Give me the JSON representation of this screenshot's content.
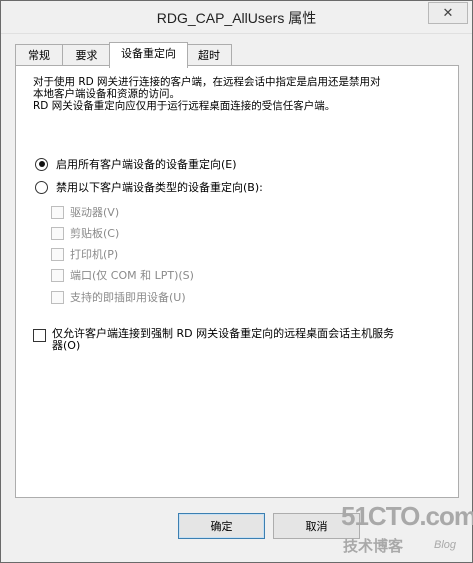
{
  "window": {
    "title": "RDG_CAP_AllUsers 属性",
    "close_glyph": "✕"
  },
  "tabs": [
    {
      "label": "常规"
    },
    {
      "label": "要求"
    },
    {
      "label": "设备重定向"
    },
    {
      "label": "超时"
    }
  ],
  "active_tab": "设备重定向",
  "description": {
    "line1": "对于使用 RD 网关进行连接的客户端，在远程会话中指定是启用还是禁用对",
    "line2": "本地客户端设备和资源的访问。",
    "line3": "RD 网关设备重定向应仅用于运行远程桌面连接的受信任客户端。"
  },
  "redirect_options": {
    "enable_all": {
      "label": "启用所有客户端设备的设备重定向(E)",
      "selected": true
    },
    "disable_types": {
      "label": "禁用以下客户端设备类型的设备重定向(B):",
      "selected": false
    }
  },
  "device_types": [
    {
      "label": "驱动器(V)",
      "checked": false
    },
    {
      "label": "剪贴板(C)",
      "checked": false
    },
    {
      "label": "打印机(P)",
      "checked": false
    },
    {
      "label": "端口(仅 COM 和 LPT)(S)",
      "checked": false
    },
    {
      "label": "支持的即插即用设备(U)",
      "checked": false
    }
  ],
  "enforce": {
    "line1": "仅允许客户端连接到强制 RD 网关设备重定向的远程桌面会话主机服务",
    "line2": "器(O)",
    "checked": false
  },
  "buttons": {
    "ok": "确定",
    "cancel": "取消"
  },
  "watermark": {
    "site": "51CTO.com",
    "tagline": "技术博客",
    "blog": "Blog"
  }
}
